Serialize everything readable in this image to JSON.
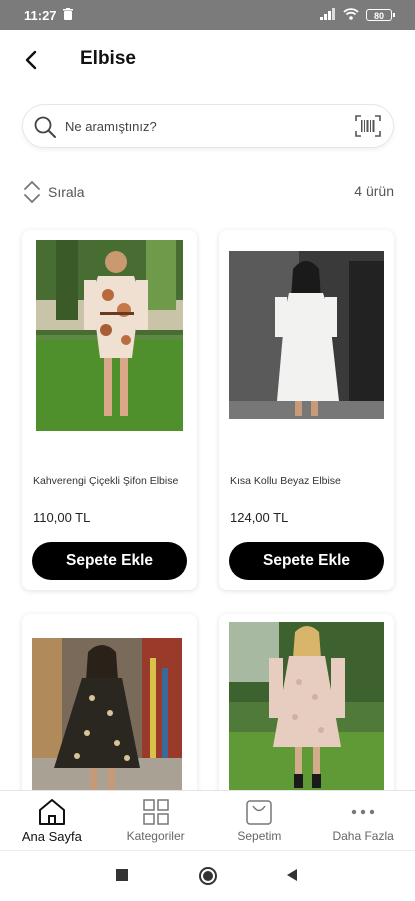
{
  "status_bar": {
    "time": "11:27",
    "battery": "80"
  },
  "header": {
    "title": "Elbise"
  },
  "search": {
    "placeholder": "Ne aramıştınız?"
  },
  "sort": {
    "label": "Sırala",
    "count": "4 ürün"
  },
  "products": [
    {
      "name": "Kahverengi Çiçekli Şifon Elbise",
      "price": "110,00 TL",
      "button": "Sepete Ekle"
    },
    {
      "name": "Kısa Kollu Beyaz Elbise",
      "price": "124,00 TL",
      "button": "Sepete Ekle"
    },
    {
      "name": "",
      "price": "",
      "button": ""
    },
    {
      "name": "",
      "price": "",
      "button": ""
    }
  ],
  "bottom_nav": [
    {
      "label": "Ana Sayfa",
      "icon": "home-icon",
      "active": true
    },
    {
      "label": "Kategoriler",
      "icon": "grid-icon",
      "active": false
    },
    {
      "label": "Sepetim",
      "icon": "bag-icon",
      "active": false
    },
    {
      "label": "Daha Fazla",
      "icon": "more-icon",
      "active": false
    }
  ],
  "colors": {
    "accent": "#000000",
    "statusbar": "#7b7b7b"
  }
}
